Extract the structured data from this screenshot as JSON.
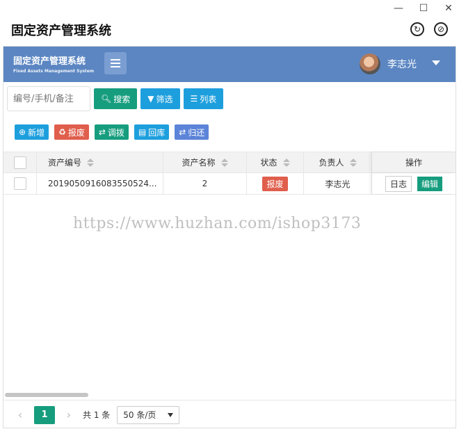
{
  "window": {
    "title": "固定资产管理系统"
  },
  "navbar": {
    "brand_cn": "固定资产管理系统",
    "brand_en": "Fixed Assets Management System",
    "user_name": "李志光"
  },
  "search": {
    "placeholder": "编号/手机/备注",
    "search_label": "搜索",
    "filter_label": "筛选",
    "list_label": "列表"
  },
  "actions": {
    "add": "新增",
    "scrap": "报废",
    "transfer": "调拨",
    "return_storage": "回库",
    "give_back": "归还"
  },
  "table": {
    "headers": {
      "asset_no": "资产编号",
      "asset_name": "资产名称",
      "status": "状态",
      "owner": "负责人",
      "ops": "操作"
    },
    "rows": [
      {
        "asset_no": "2019050916083550524...",
        "asset_name": "2",
        "status": "报废",
        "owner": "李志光",
        "log": "日志",
        "edit": "编辑"
      }
    ]
  },
  "watermark": "https://www.huzhan.com/ishop3173",
  "pagination": {
    "current_page": "1",
    "total": "共 1 条",
    "page_size": "50 条/页"
  },
  "colors": {
    "navbar": "#5b86c2",
    "green": "#169d7e",
    "blue": "#1e9fdd",
    "red": "#e05e4c"
  }
}
